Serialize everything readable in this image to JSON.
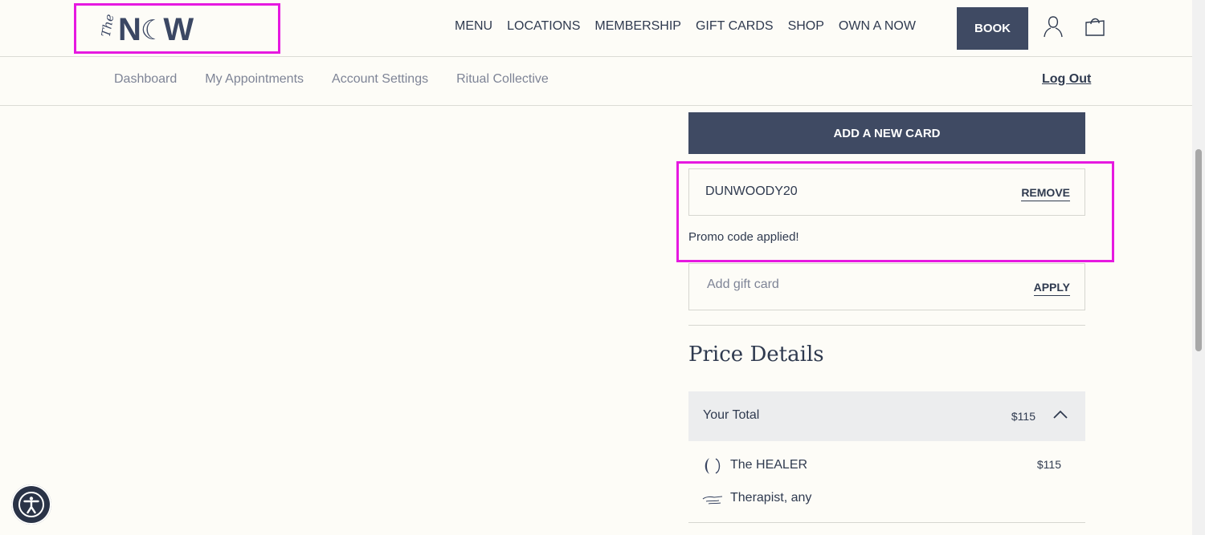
{
  "brand": {
    "the": "The",
    "left": "N",
    "moon": "☾",
    "right": "W"
  },
  "nav": {
    "items": [
      "MENU",
      "LOCATIONS",
      "MEMBERSHIP",
      "GIFT CARDS",
      "SHOP",
      "OWN A NOW"
    ],
    "book": "BOOK"
  },
  "subnav": {
    "items": [
      "Dashboard",
      "My Appointments",
      "Account Settings",
      "Ritual Collective"
    ],
    "logout": "Log Out"
  },
  "payment": {
    "add_card": "ADD A NEW CARD"
  },
  "promo": {
    "code": "DUNWOODY20",
    "remove": "REMOVE",
    "message": "Promo code applied!"
  },
  "gift": {
    "placeholder": "Add gift card",
    "apply": "APPLY"
  },
  "price": {
    "title": "Price Details",
    "total_label": "Your Total",
    "total_amount": "$115",
    "items": [
      {
        "name": "The HEALER",
        "amount": "$115",
        "icon": "moon-icon"
      },
      {
        "name": "Therapist, any",
        "amount": "",
        "icon": "hand-icon"
      }
    ]
  },
  "colors": {
    "primary": "#3f4a63",
    "highlight": "#e619e0",
    "background": "#fdfcf7"
  }
}
